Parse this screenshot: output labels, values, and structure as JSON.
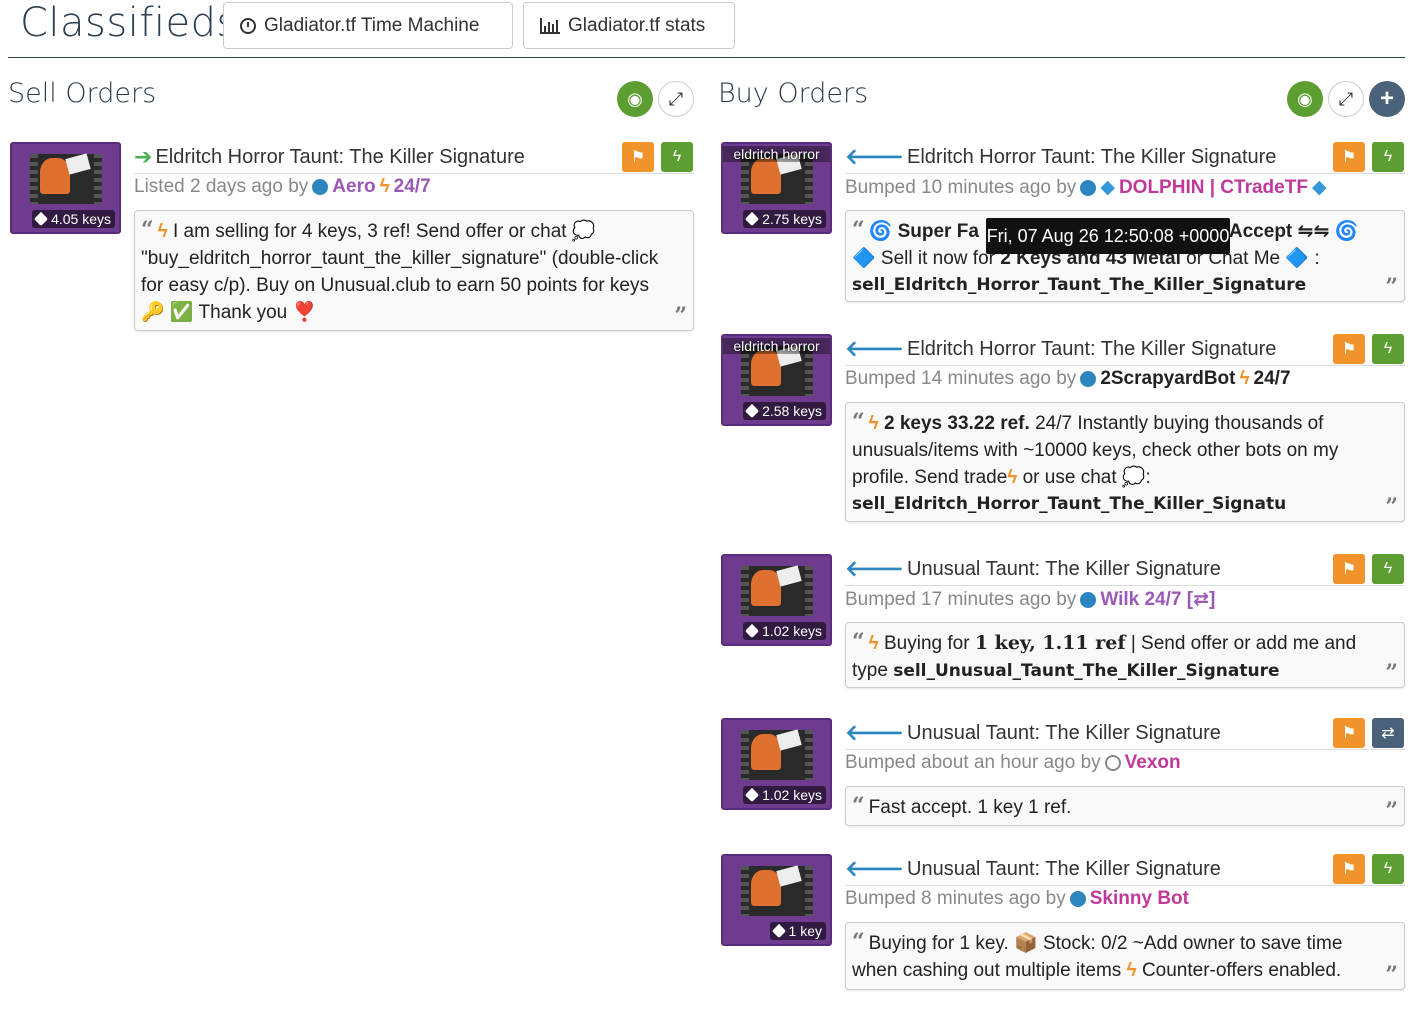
{
  "header": {
    "title": "Classifieds",
    "time_machine_label": "Gladiator.tf Time Machine",
    "stats_label": "Gladiator.tf stats"
  },
  "sell": {
    "heading": "Sell Orders",
    "listings": [
      {
        "thumb_label": "",
        "price": "4.05 keys",
        "title": "Eldritch Horror Taunt: The Killer Signature",
        "listed": "Listed 2 days ago by",
        "user": "Aero",
        "suffix": "24/7",
        "msg_lines": [
          "I am selling for 4 keys, 3 ref! Send offer or chat 💭",
          "\"buy_eldritch_horror_taunt_the_killer_signature\" (double-click",
          "for easy c/p). Buy on Unusual.club to earn 50 points for keys",
          "🔑 ✅ Thank you ❣️"
        ]
      }
    ]
  },
  "buy": {
    "heading": "Buy Orders",
    "listings": [
      {
        "thumb_label": "eldritch horror",
        "price": "2.75 keys",
        "title": "Eldritch Horror Taunt: The Killer Signature",
        "listed": "Bumped 10 minutes ago by",
        "user": "DOLPHIN | CTradeTF",
        "msg_a": "🌀 Super Fa",
        "msg_b": "Accept ⇋⇋ 🌀",
        "msg_c": "🔷 Sell it now for",
        "msg_d": "2 Keys and 43 Metal",
        "msg_e": "or Chat Me 🔷 :",
        "msg_f": "sell_Eldritch_Horror_Taunt_The_Killer_Signature"
      },
      {
        "thumb_label": "eldritch horror",
        "price": "2.58 keys",
        "title": "Eldritch Horror Taunt: The Killer Signature",
        "listed": "Bumped 14 minutes ago by",
        "user": "2ScrapyardBot",
        "suffix": "24/7",
        "msg_a": "2 keys 33.22 ref.",
        "msg_b": "24/7 Instantly buying thousands of",
        "msg_c": "unusuals/items with ~10000 keys, check other bots on my",
        "msg_d": "profile. Send  trade",
        "msg_e": "or  use  chat 💭:",
        "msg_f": "sell_Eldritch_Horror_Taunt_The_Killer_Signatu"
      },
      {
        "thumb_label": "",
        "price": "1.02 keys",
        "title": "Unusual Taunt: The Killer Signature",
        "listed": "Bumped 17 minutes ago by",
        "user": "Wilk 24/7 [⇄]",
        "msg_a": "Buying for",
        "msg_b": "1 key, 1.11 ref",
        "msg_c": "| Send offer or add me and",
        "msg_d": "type",
        "msg_e": "sell_Unusual_Taunt_The_Killer_Signature"
      },
      {
        "thumb_label": "",
        "price": "1.02 keys",
        "title": "Unusual Taunt: The Killer Signature",
        "listed": "Bumped about an hour ago by",
        "user": "Vexon",
        "msg_a": "Fast accept. 1 key 1 ref."
      },
      {
        "thumb_label": "",
        "price": "1 key",
        "title": "Unusual Taunt: The Killer Signature",
        "listed": "Bumped 8 minutes ago by",
        "user": "Skinny Bot",
        "msg_a": "Buying for 1 key. 📦 Stock: 0/2 ~Add owner to save time",
        "msg_b": "when cashing out multiple items",
        "msg_c": "Counter-offers enabled."
      }
    ]
  },
  "tooltip": "Fri, 07 Aug 26 12:50:08 +0000",
  "colors": {
    "purple_user": "#9b59b6",
    "pink_user": "#c0399a",
    "black_user": "#222222",
    "accent_orange": "#f0932b",
    "accent_green": "#5c9e31"
  }
}
